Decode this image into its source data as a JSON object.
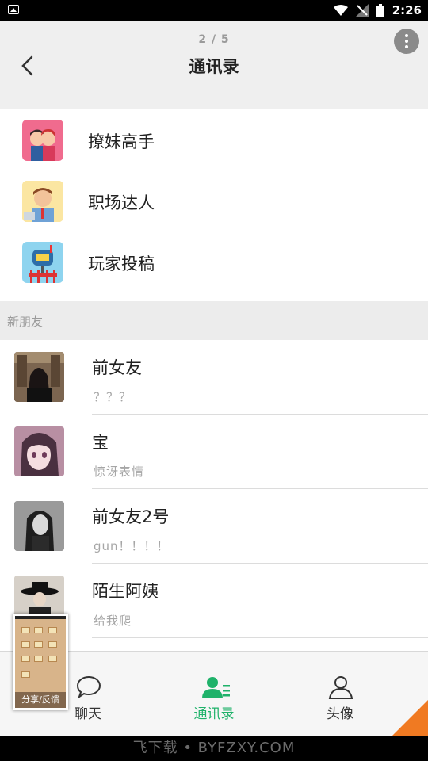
{
  "status_bar": {
    "time": "2:26"
  },
  "header": {
    "page_indicator": "2 / 5",
    "title": "通讯录"
  },
  "official_accounts": [
    {
      "name": "撩妹高手",
      "icon": "couple-kiss-icon"
    },
    {
      "name": "职场达人",
      "icon": "office-worker-icon"
    },
    {
      "name": "玩家投稿",
      "icon": "mailbox-icon"
    }
  ],
  "section": {
    "title": "新朋友"
  },
  "friends": [
    {
      "name": "前女友",
      "message": "？？？"
    },
    {
      "name": "宝",
      "message": "惊讶表情"
    },
    {
      "name": "前女友2号",
      "message": "gun！！！！"
    },
    {
      "name": "陌生阿姨",
      "message": "给我爬"
    }
  ],
  "tabbar": {
    "tabs": [
      {
        "label": "聊天",
        "icon": "chat-bubble-icon",
        "active": false
      },
      {
        "label": "通讯录",
        "icon": "contacts-icon",
        "active": true
      },
      {
        "label": "头像",
        "icon": "person-icon",
        "active": false
      }
    ]
  },
  "share_widget": {
    "label": "分享/反馈"
  },
  "watermark": "飞下载 • BYFZXY.COM",
  "colors": {
    "accent": "#1fb26a",
    "header_bg": "#efefef",
    "section_bg": "#ececec"
  }
}
